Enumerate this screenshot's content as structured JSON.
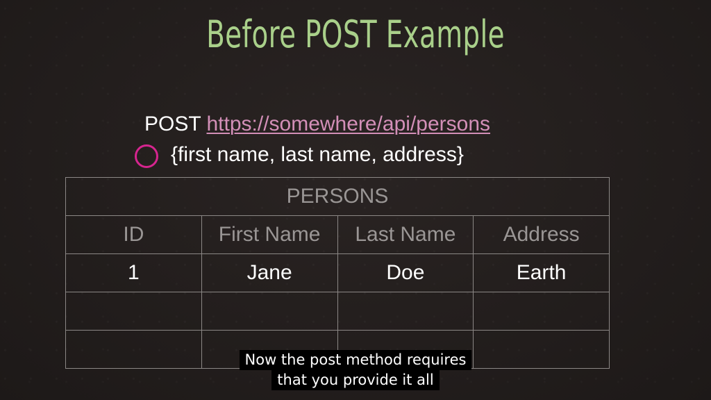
{
  "slide": {
    "title": "Before POST Example",
    "request": {
      "method": "POST",
      "url": "https://somewhere/api/persons",
      "body": "{first name, last name, address}"
    },
    "table": {
      "caption": "PERSONS",
      "columns": [
        "ID",
        "First Name",
        "Last Name",
        "Address"
      ],
      "rows": [
        [
          "1",
          "Jane",
          "Doe",
          "Earth"
        ],
        [
          "",
          "",
          "",
          ""
        ],
        [
          "",
          "",
          "",
          ""
        ]
      ]
    }
  },
  "subtitles": {
    "line1": "Now the post method requires",
    "line2": "that you provide it all"
  },
  "colors": {
    "background": "#211c1b",
    "title": "#a9d08a",
    "link": "#d38fb8",
    "circle": "#d6258f",
    "header_text": "#9a9695",
    "grid": "#8c8886"
  },
  "icons": {
    "body_marker": "circle-icon"
  }
}
